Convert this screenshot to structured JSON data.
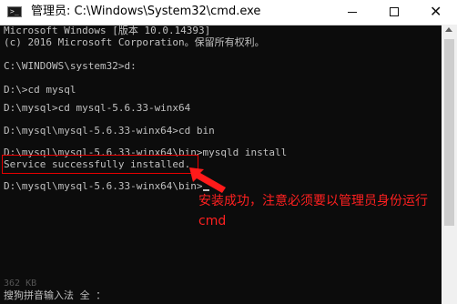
{
  "window": {
    "title": "管理员: C:\\Windows\\System32\\cmd.exe",
    "icon": "cmd-prompt-icon",
    "icon_glyph": ">_",
    "buttons": {
      "minimize_icon": "minimize-icon",
      "maximize_icon": "maximize-icon",
      "close_icon": "close-icon",
      "close_glyph": "✕"
    }
  },
  "console": {
    "lines": [
      "Microsoft Windows [版本 10.0.14393]",
      "(c) 2016 Microsoft Corporation。保留所有权利。",
      "",
      "C:\\WINDOWS\\system32>d:",
      "",
      "D:\\>cd mysql",
      "",
      "D:\\mysql>cd mysql-5.6.33-winx64",
      "",
      "D:\\mysql\\mysql-5.6.33-winx64>cd bin",
      "",
      "D:\\mysql\\mysql-5.6.33-winx64\\bin>mysqld install",
      "Service successfully installed.",
      "",
      "D:\\mysql\\mysql-5.6.33-winx64\\bin>"
    ],
    "ime_status": "搜狗拼音输入法 全 ：",
    "ime_ghost": "362 KB"
  },
  "annotation": {
    "text": "安装成功，注意必须要以管理员身份运行cmd",
    "color": "#ff2020"
  },
  "colors": {
    "console_bg": "#0c0c0c",
    "console_fg": "#c0c0c0",
    "highlight": "#e60000"
  }
}
